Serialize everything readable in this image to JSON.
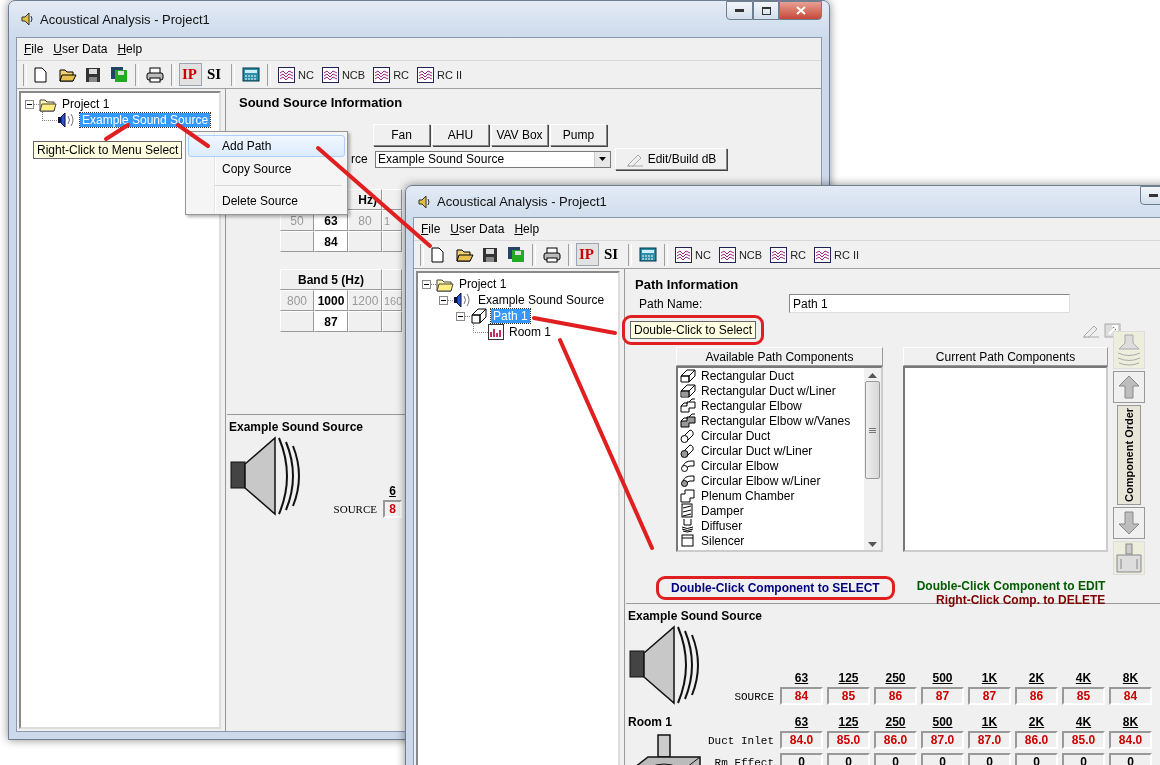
{
  "back_window": {
    "title": "Acoustical Analysis - Project1",
    "menu": [
      "File",
      "User Data",
      "Help"
    ],
    "units": [
      {
        "label": "IP",
        "selected": true,
        "color": "#cc0000"
      },
      {
        "label": "SI",
        "selected": false,
        "color": "#000000"
      }
    ],
    "charts": [
      "NC",
      "NCB",
      "RC",
      "RC II"
    ],
    "tree": [
      {
        "label": "Project 1",
        "kind": "folder",
        "expanded": true,
        "selected": false,
        "children": [
          {
            "label": "Example Sound Source",
            "kind": "source",
            "selected": true
          }
        ]
      }
    ],
    "tooltip": "Right-Click to Menu Select",
    "context_menu": [
      {
        "label": "Add Path",
        "highlighted": true,
        "separator_before": false
      },
      {
        "label": "Copy Source",
        "highlighted": false,
        "separator_before": false
      },
      {
        "label": "Delete Source",
        "highlighted": false,
        "separator_before": true
      }
    ],
    "panel": {
      "heading": "Sound Source Information",
      "source_types": [
        "Fan",
        "AHU",
        "VAV Box",
        "Pump"
      ],
      "source_label": "rce",
      "source_select": "Example Sound Source",
      "edit_button": "Edit/Build dB",
      "band_tables": [
        {
          "header": "Hz)",
          "frequencies": [
            {
              "label": "50",
              "current": false
            },
            {
              "label": "63",
              "current": true,
              "value": "84"
            },
            {
              "label": "80",
              "current": false
            },
            {
              "label": "1",
              "current": false
            }
          ]
        },
        {
          "header": "Band 5 (Hz)",
          "frequencies": [
            {
              "label": "800",
              "current": false
            },
            {
              "label": "1000",
              "current": true,
              "value": "87"
            },
            {
              "label": "1200",
              "current": false
            },
            {
              "label": "160",
              "current": false
            }
          ]
        }
      ]
    },
    "summary": {
      "title": "Example Sound Source",
      "band": "6",
      "row_label": "SOURCE",
      "value": "8"
    }
  },
  "front_window": {
    "title": "Acoustical Analysis - Project1",
    "menu": [
      "File",
      "User Data",
      "Help"
    ],
    "units": [
      {
        "label": "IP",
        "selected": true,
        "color": "#cc0000"
      },
      {
        "label": "SI",
        "selected": false,
        "color": "#000000"
      }
    ],
    "charts": [
      "NC",
      "NCB",
      "RC",
      "RC II"
    ],
    "tree": [
      {
        "label": "Project 1",
        "kind": "folder",
        "expanded": true,
        "selected": false,
        "children": [
          {
            "label": "Example Sound Source",
            "kind": "source",
            "expanded": true,
            "selected": false,
            "children": [
              {
                "label": "Path 1",
                "kind": "path",
                "expanded": true,
                "selected": true,
                "children": [
                  {
                    "label": "Room 1",
                    "kind": "room",
                    "selected": false
                  }
                ]
              }
            ]
          }
        ]
      }
    ],
    "path_info": {
      "heading": "Path Information",
      "name_label": "Path Name:",
      "name_value": "Path 1",
      "tooltip": "Double-Click to Select"
    },
    "available": {
      "header": "Available Path Components",
      "items": [
        {
          "label": "Rectangular Duct",
          "kind": "rect_duct",
          "lined": false
        },
        {
          "label": "Rectangular Duct w/Liner",
          "kind": "rect_duct",
          "lined": true
        },
        {
          "label": "Rectangular Elbow",
          "kind": "rect_elbow",
          "lined": false
        },
        {
          "label": "Rectangular Elbow w/Vanes",
          "kind": "rect_elbow",
          "lined": true
        },
        {
          "label": "Circular Duct",
          "kind": "circ_duct",
          "lined": false
        },
        {
          "label": "Circular Duct w/Liner",
          "kind": "circ_duct",
          "lined": true
        },
        {
          "label": "Circular Elbow",
          "kind": "circ_elbow",
          "lined": false
        },
        {
          "label": "Circular Elbow w/Liner",
          "kind": "circ_elbow",
          "lined": true
        },
        {
          "label": "Plenum Chamber",
          "kind": "plenum"
        },
        {
          "label": "Damper",
          "kind": "damper"
        },
        {
          "label": "Diffuser",
          "kind": "diffuser"
        },
        {
          "label": "Silencer",
          "kind": "silencer"
        }
      ]
    },
    "current": {
      "header": "Current Path Components"
    },
    "order_label": "Component Order",
    "select_note": {
      "text": "Double-Click Component to SELECT",
      "color": "#00007f"
    },
    "edit_notes": [
      {
        "text": "Double-Click Component to EDIT",
        "color": "#005a00"
      },
      {
        "text": "Right-Click Comp. to DELETE",
        "color": "#7f0000"
      }
    ],
    "summary": {
      "title": "Example Sound Source",
      "bands": [
        "63",
        "125",
        "250",
        "500",
        "1K",
        "2K",
        "4K",
        "8K"
      ],
      "rows": [
        {
          "label": "SOURCE",
          "color": "#cc0000",
          "values": [
            "84",
            "85",
            "86",
            "87",
            "87",
            "86",
            "85",
            "84"
          ]
        }
      ]
    },
    "room": {
      "title": "Room 1",
      "bands": [
        "63",
        "125",
        "250",
        "500",
        "1K",
        "2K",
        "4K",
        "8K"
      ],
      "rows": [
        {
          "label": "Duct Inlet",
          "color": "#cc0000",
          "values": [
            "84.0",
            "85.0",
            "86.0",
            "87.0",
            "87.0",
            "86.0",
            "85.0",
            "84.0"
          ]
        },
        {
          "label": "Rm Effect",
          "color": "#000000",
          "values": [
            "0",
            "0",
            "0",
            "0",
            "0",
            "0",
            "0",
            "0"
          ]
        }
      ]
    }
  }
}
